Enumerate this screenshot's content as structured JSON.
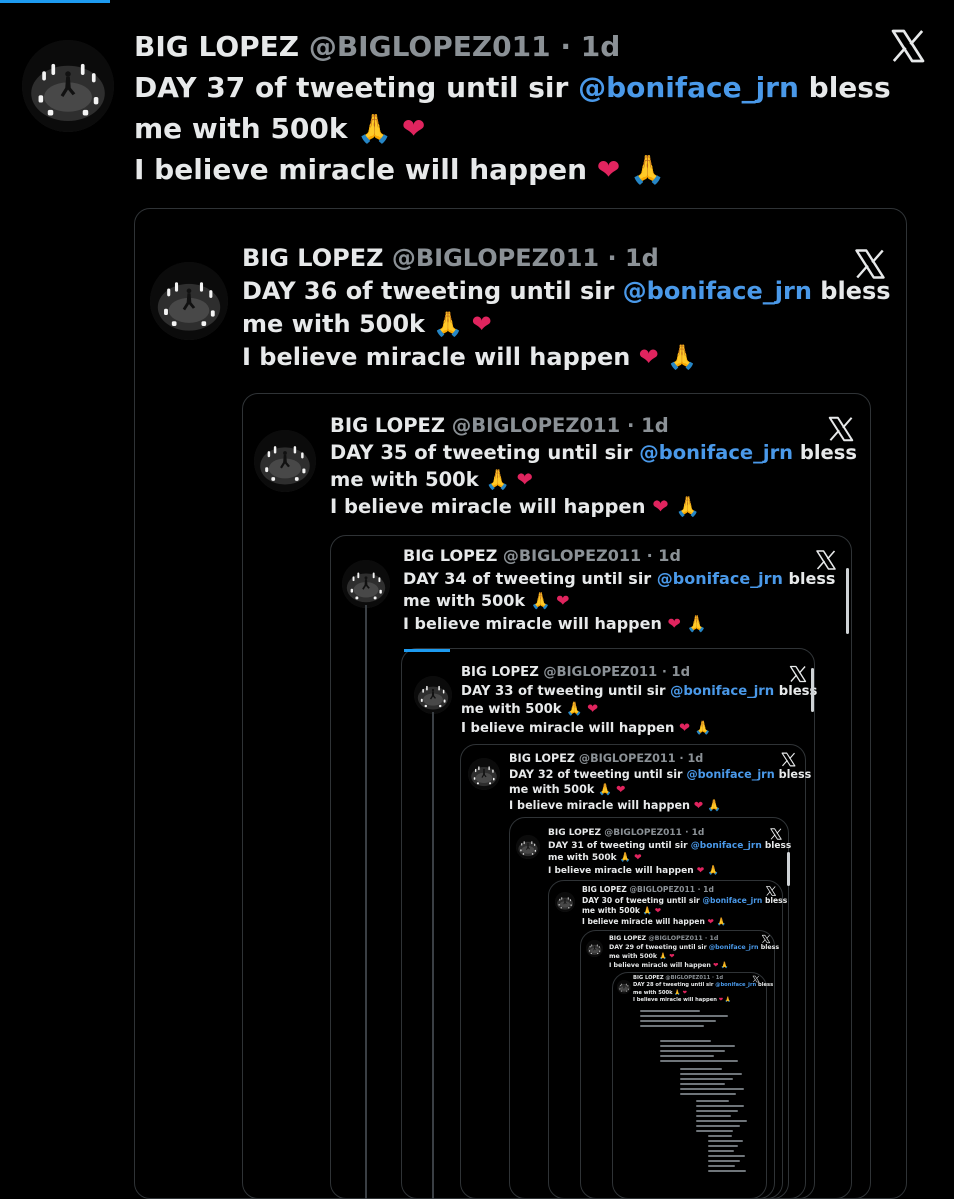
{
  "tweets": [
    {
      "name": "BIG LOPEZ",
      "handle": "@BIGLOPEZ011 · 1d",
      "line1": "DAY 37 of tweeting until sir ",
      "mention": "@boniface_jrn",
      "line1_end": " bless",
      "line2": "me with 500k",
      "line3": "I believe miracle will happen"
    },
    {
      "name": "BIG LOPEZ",
      "handle": "@BIGLOPEZ011 · 1d",
      "line1": "DAY 36 of tweeting until sir ",
      "mention": "@boniface_jrn",
      "line1_end": " bless",
      "line2": "me with 500k",
      "line3": "I believe miracle will happen"
    },
    {
      "name": "BIG LOPEZ",
      "handle": "@BIGLOPEZ011 · 1d",
      "line1": "DAY 35 of tweeting until sir ",
      "mention": "@boniface_jrn",
      "line1_end": " bless",
      "line2": "me with 500k",
      "line3": "I believe miracle will happen"
    },
    {
      "name": "BIG LOPEZ",
      "handle": "@BIGLOPEZ011 · 1d",
      "line1": "DAY 34 of tweeting until sir ",
      "mention": "@boniface_jrn",
      "line1_end": " bless",
      "line2": "me with 500k",
      "line3": "I believe miracle will happen"
    },
    {
      "name": "BIG LOPEZ",
      "handle": "@BIGLOPEZ011 · 1d",
      "line1": "DAY 33 of tweeting until sir ",
      "mention": "@boniface_jrn",
      "line1_end": " bless",
      "line2": "me with 500k",
      "line3": "I believe miracle will happen"
    },
    {
      "name": "BIG LOPEZ",
      "handle": "@BIGLOPEZ011 · 1d",
      "line1": "DAY 32 of tweeting until sir ",
      "mention": "@boniface_jrn",
      "line1_end": " bless",
      "line2": "me with 500k",
      "line3": "I believe miracle will happen"
    },
    {
      "name": "BIG LOPEZ",
      "handle": "@BIGLOPEZ011 · 1d",
      "line1": "DAY 31 of tweeting until sir ",
      "mention": "@boniface_jrn",
      "line1_end": " bless",
      "line2": "me with 500k",
      "line3": "I believe miracle will happen"
    },
    {
      "name": "BIG LOPEZ",
      "handle": "@BIGLOPEZ011 · 1d",
      "line1": "DAY 30 of tweeting until sir ",
      "mention": "@boniface_jrn",
      "line1_end": " bless",
      "line2": "me with 500k",
      "line3": "I believe miracle will happen"
    },
    {
      "name": "BIG LOPEZ",
      "handle": "@BIGLOPEZ011 · 1d",
      "line1": "DAY 29 of tweeting until sir ",
      "mention": "@boniface_jrn",
      "line1_end": " bless",
      "line2": "me with 500k",
      "line3": "I believe miracle will happen"
    },
    {
      "name": "BIG LOPEZ",
      "handle": "@BIGLOPEZ011 · 1d",
      "line1": "DAY 28 of tweeting until sir ",
      "mention": "@boniface_jrn",
      "line1_end": " bless",
      "line2": "me with 500k",
      "line3": "I believe miracle will happen"
    }
  ],
  "emoji": {
    "pray": "🙏",
    "heart": "❤"
  },
  "icons": {
    "platform": "x-logo-icon",
    "avatar": "profile-avatar"
  },
  "colors": {
    "background": "#000000",
    "text": "#e7e9ea",
    "handle": "#8b9196",
    "mention": "#4a99e9",
    "heart": "#e0245e",
    "accent": "#1d9bf0",
    "border": "#2f3336"
  }
}
